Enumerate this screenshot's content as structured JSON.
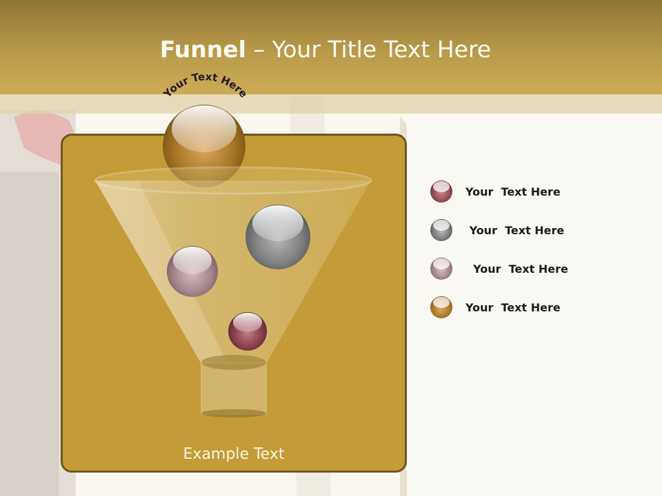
{
  "slide": {
    "title_bold": "Funnel",
    "title_rest": " – Your Title Text Here",
    "top_arc_text": "Your Text Here",
    "example_text": "Example Text"
  },
  "legend": [
    {
      "label": "Your  Text Here",
      "color": "#9a4f58"
    },
    {
      "label": " Your  Text Here",
      "color": "#7d7f80"
    },
    {
      "label": "  Your  Text Here",
      "color": "#a88a8f"
    },
    {
      "label": "Your  Text Here",
      "color": "#b07c2e"
    }
  ],
  "colors": {
    "header": "#b99a4a",
    "panel": "#c49b37",
    "panel_border": "#6b571e",
    "ball_gold": "#a67424",
    "ball_gray": "#7e8081",
    "ball_mauve": "#a3878c",
    "ball_maroon": "#8a3f4c"
  }
}
